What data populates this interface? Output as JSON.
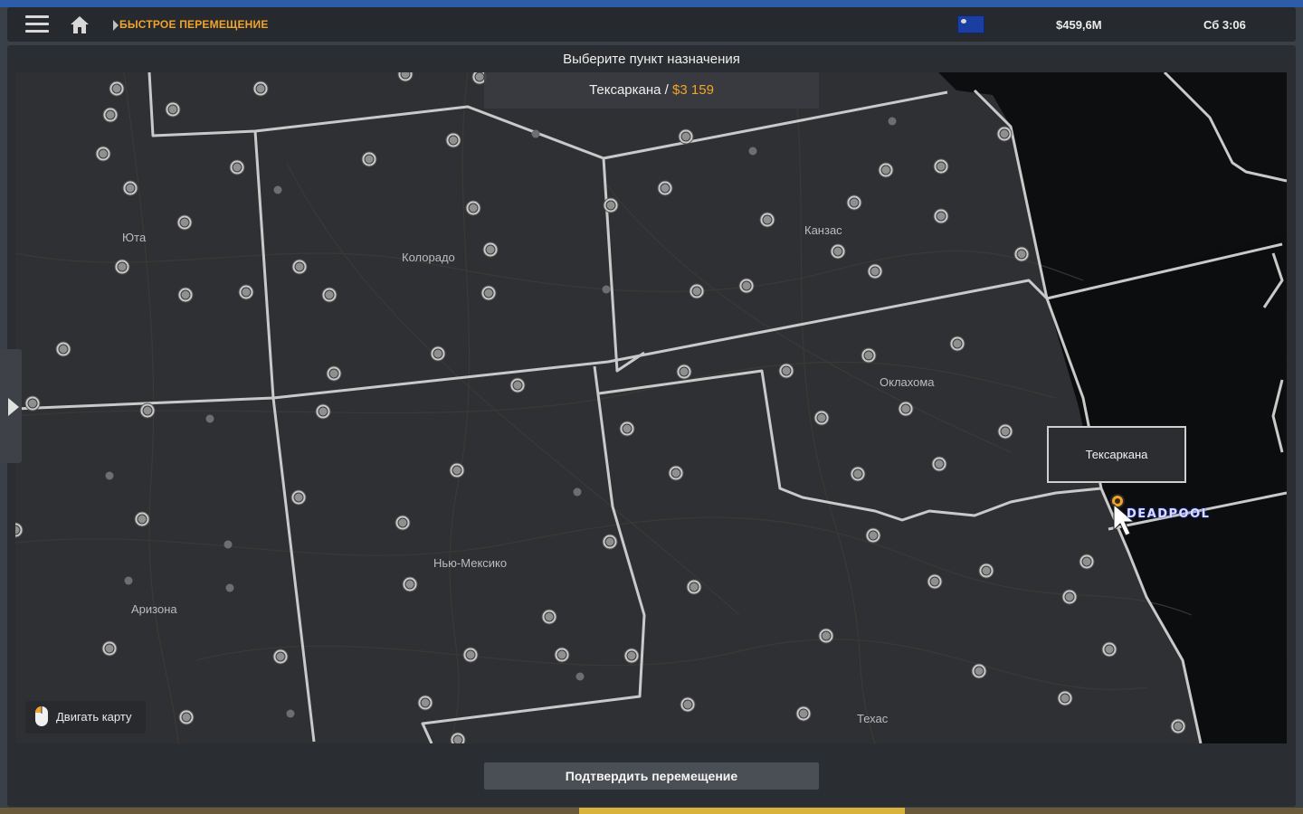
{
  "topbar": {
    "breadcrumb": "БЫСТРОЕ ПЕРЕМЕЩЕНИЕ",
    "money": "$459,6M",
    "clock": "Сб 3:06",
    "flag_icon": "nevada-flag-icon"
  },
  "panel": {
    "title": "Выберите пункт назначения"
  },
  "destination": {
    "city": "Тексаркана",
    "separator": " / ",
    "price": "$3 159"
  },
  "map": {
    "states": [
      "Юта",
      "Колорадо",
      "Канзас",
      "Аризона",
      "Нью-Мексико",
      "Оклахома",
      "Техас"
    ],
    "selected_city_tooltip": "Тексаркана",
    "player_name": "DEADPOOL"
  },
  "hint": {
    "move_map": "Двигать карту"
  },
  "buttons": {
    "confirm": "Подтвердить перемещение"
  },
  "colors": {
    "accent": "#f2a42a",
    "panel": "#2a2d31",
    "map_land": "#2f3033",
    "map_border": "#c8c8c8"
  }
}
